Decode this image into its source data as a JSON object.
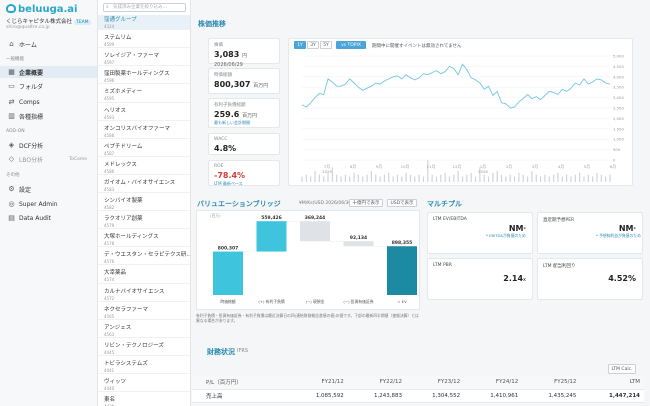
{
  "app": {
    "logo": "beluuga.ai",
    "org": "くじらキャピタル株式会社",
    "team": "TEAM",
    "email": "shiro@qualtre.co.jp"
  },
  "nav": {
    "home": "ホーム",
    "section_general": "一般機能",
    "company_overview": "企業概要",
    "folder": "フォルダ",
    "comps": "Comps",
    "indicators": "各種指標",
    "section_addon": "ADD-ON",
    "dcf": "DCF分析",
    "lbo": "LBO分析",
    "lbo_badge": "ToCome",
    "section_other": "その他",
    "settings": "設定",
    "super_admin": "Super Admin",
    "data_audit": "Data Audit"
  },
  "search": {
    "placeholder": "気成済み企業を絞り込み..."
  },
  "companies": [
    {
      "name": "窪通グループ",
      "code": "4324"
    },
    {
      "name": "ステムリム",
      "code": "4599"
    },
    {
      "name": "ソレイジア・ファーマ",
      "code": "4597"
    },
    {
      "name": "窪田製薬ホールディングス",
      "code": "4596"
    },
    {
      "name": "ミズホメディー",
      "code": "4595"
    },
    {
      "name": "ヘリオス",
      "code": "4593"
    },
    {
      "name": "オンコリスバイオファーマ",
      "code": "4588"
    },
    {
      "name": "ペプチドリーム",
      "code": "4587"
    },
    {
      "name": "メドレックス",
      "code": "4586"
    },
    {
      "name": "ガイオム・バイオサイエンス",
      "code": "4583"
    },
    {
      "name": "シンバイオ製薬",
      "code": "4582"
    },
    {
      "name": "ラクオリア創薬",
      "code": "4579"
    },
    {
      "name": "大塚ホールディングス",
      "code": "4578"
    },
    {
      "name": "デ・ウエスタン・セラピテクス研...",
      "code": "4576"
    },
    {
      "name": "大幸薬品",
      "code": "4574"
    },
    {
      "name": "カルナバイオサイエンス",
      "code": "4572"
    },
    {
      "name": "ネクセラファーマ",
      "code": "4565"
    },
    {
      "name": "アンジェス",
      "code": "4563"
    },
    {
      "name": "リビン・テクノロジーズ",
      "code": "4445"
    },
    {
      "name": "トビラシステムズ",
      "code": "4441"
    },
    {
      "name": "ヴィッツ",
      "code": "4440"
    },
    {
      "name": "東名",
      "code": "4439"
    }
  ],
  "stock": {
    "title": "株価推移",
    "price_label": "株価",
    "price": "3,083",
    "price_date": "円 2026/06/29",
    "mcap_label": "時価総額",
    "mcap": "800,307",
    "mcap_unit": "百万円",
    "debt_label": "有利子負債総額",
    "debt": "259.6",
    "debt_unit": "百万円",
    "debt_sub": "最も新しい会計期間",
    "wacc_label": "WACC",
    "wacc": "4.8%",
    "roe_label": "ROE",
    "roe": "-78.4%",
    "roe_sub": "LTM 最新ベース",
    "range_buttons": [
      "1Y",
      "3Y",
      "5Y"
    ],
    "compare_label": "vs TOPIX",
    "note": "期間中に開催すイベントは無効されてません",
    "chart_data": {
      "type": "line",
      "x_ticks": [
        "7月\n2025",
        "8月",
        "9月",
        "10月",
        "11月",
        "12月",
        "1月\n2026",
        "2月",
        "3月",
        "4月",
        "5月",
        "6月"
      ],
      "ylim": [
        0,
        5000
      ],
      "y_ticks": [
        "5,000",
        "4,500",
        "4,000",
        "3,500",
        "3,000",
        "2,500",
        "2,000",
        "1,500",
        "1,000",
        "500",
        "0"
      ],
      "values": [
        2650,
        2550,
        2750,
        3000,
        3200,
        3150,
        3900,
        3750,
        3550,
        3550,
        3650,
        3900,
        3700,
        3500,
        3350,
        3450,
        3550,
        3700,
        3650,
        3800,
        3900,
        4000,
        4050,
        3900,
        4100,
        3950,
        3850,
        3950,
        4150,
        4100,
        4200,
        4300,
        4150,
        4250,
        4500,
        4400,
        4100,
        4600,
        4350,
        3950,
        3850,
        3700,
        3400,
        3550,
        3100,
        3300,
        2750,
        2700,
        2500,
        2550,
        2800,
        2950,
        3150,
        2950,
        3050,
        2900,
        3100,
        3300,
        3250,
        3150,
        3400,
        3300,
        3450,
        3700,
        3600,
        3900,
        3650,
        3750,
        3900,
        3850,
        3700,
        3650
      ],
      "volume": [
        3,
        4,
        3,
        6,
        4,
        3,
        5,
        8,
        4,
        3,
        4,
        3,
        5,
        4,
        3,
        4,
        6,
        4,
        3,
        4,
        5,
        3,
        4,
        3,
        5,
        4,
        3,
        4,
        3,
        12,
        4,
        3,
        4,
        5,
        3,
        4,
        6,
        3,
        4,
        5,
        3,
        8,
        4,
        3,
        5,
        6,
        4,
        3,
        4,
        3,
        5,
        4,
        3,
        6,
        4,
        3,
        4,
        3,
        4,
        5,
        3,
        4,
        3,
        4,
        5,
        3,
        4,
        3,
        5,
        4,
        3,
        4
      ]
    }
  },
  "valuation": {
    "title": "バリュエーションブリッジ",
    "unit": "¥M/Ks(USD 2026/06/30)",
    "btn_million": "十億円で表示",
    "btn_usd": "USDで表示",
    "chart_data": {
      "type": "bar",
      "categories": [
        "時価総額",
        "(+) 有利子負債",
        "(−) 現預金",
        "(−) 投資有価証券",
        "= EV"
      ],
      "values": [
        800307,
        559426,
        369244,
        92134,
        898355
      ],
      "labels": [
        "800,307",
        "559,426",
        "369,244",
        "92,134",
        "898,355"
      ],
      "ylabel": "(百万)"
    },
    "footnote": "有利子負債・投資有価証券・有利子負債は最近決算日の四(連結財務報告書値の値)の値です。下部の最新四半期値（速報決算）とは異なる場合があります。"
  },
  "multiples": {
    "title": "マルチプル",
    "items": [
      {
        "label": "LTM EV/EBITDA",
        "value": "NM",
        "suffix": "*",
        "sub": "* EBITDAが負値のため"
      },
      {
        "label": "直近期予想PER",
        "value": "NM",
        "suffix": "*",
        "sub": "* 予想純利益が負値のため"
      },
      {
        "label": "LTM PBR",
        "value": "2.14",
        "suffix": "x",
        "sub": ""
      },
      {
        "label": "LTM 配当利回り",
        "value": "4.52%",
        "suffix": "",
        "sub": ""
      }
    ]
  },
  "financials": {
    "title": "財務状況",
    "basis": "IFRS",
    "ltm_button": "LTM Calc.",
    "headers": [
      "P/L（百万円）",
      "FY21/12",
      "FY22/12",
      "FY23/12",
      "FY24/12",
      "FY25/12",
      "LTM"
    ],
    "rows": [
      {
        "label": "売上高",
        "values": [
          "1,085,592",
          "1,243,883",
          "1,304,552",
          "1,410,961",
          "1,435,245",
          "1,447,214"
        ]
      }
    ]
  },
  "colors": {
    "accent": "#2a8ab0",
    "bridge_primary": "#3fc4de",
    "bridge_gray": "#dfe3e8",
    "bridge_dark": "#1d8aa3",
    "line": "#6fc7e0"
  }
}
